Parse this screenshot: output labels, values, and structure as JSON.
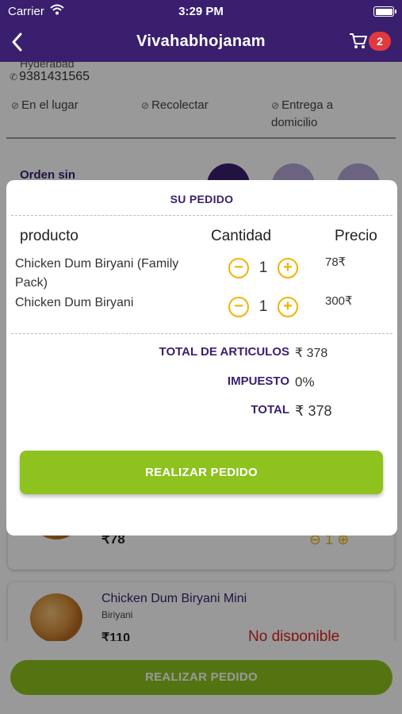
{
  "status_bar": {
    "carrier": "Carrier",
    "time": "3:29 PM"
  },
  "nav": {
    "title": "Vivahabhojanam",
    "cart_count": "2"
  },
  "background": {
    "address": "Hyderabad",
    "phone": "9381431565",
    "options": [
      "En el lugar",
      "Recolectar",
      "Entrega a domicilio"
    ],
    "order_label": "Orden sin",
    "card1": {
      "price": "₹78",
      "qty": "1"
    },
    "card2": {
      "name": "Chicken Dum Biryani Mini",
      "category": "Biriyani",
      "price": "₹110",
      "status": "No disponible"
    },
    "bottom_button": "REALIZAR PEDIDO"
  },
  "modal": {
    "title": "SU PEDIDO",
    "headers": {
      "product": "producto",
      "quantity": "Cantidad",
      "price": "Precio"
    },
    "items": [
      {
        "name": "Chicken Dum Biryani (Family Pack)",
        "qty": "1",
        "price": "78₹"
      },
      {
        "name": "Chicken Dum Biryani",
        "qty": "1",
        "price": "300₹"
      }
    ],
    "totals": {
      "items_label": "TOTAL DE ARTICULOS",
      "items_value": "₹ 378",
      "tax_label": "IMPUESTO",
      "tax_value": "0%",
      "total_label": "TOTAL",
      "total_value": "₹ 378"
    },
    "order_button": "REALIZAR PEDIDO"
  },
  "colors": {
    "brand_purple": "#3a1f6e",
    "accent_green": "#8dc21f",
    "stepper_yellow": "#f0b400",
    "badge_red": "#e0393e"
  }
}
